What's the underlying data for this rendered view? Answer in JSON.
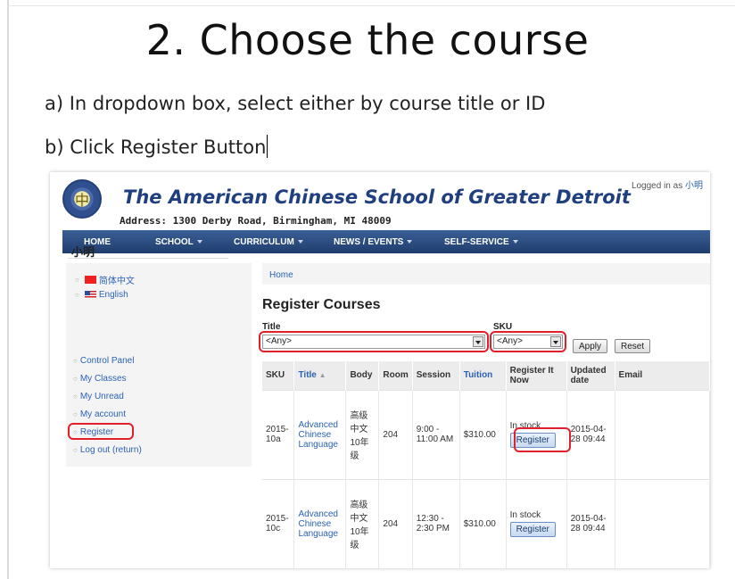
{
  "slide": {
    "title": "2. Choose the course",
    "bullet_a": "a) In dropdown box, select either by course title or ID",
    "bullet_b": "b) Click Register Button"
  },
  "site": {
    "school_name": "The American Chinese School of Greater Detroit",
    "address": "Address: 1300 Derby Road, Birmingham, MI 48009",
    "logged_in_prefix": "Logged in as",
    "logged_in_user": "小明",
    "logo_glyph": "中"
  },
  "nav": [
    {
      "label": "HOME",
      "dropdown": false
    },
    {
      "label": "SCHOOL",
      "dropdown": true
    },
    {
      "label": "CURRICULUM",
      "dropdown": true
    },
    {
      "label": "NEWS / EVENTS",
      "dropdown": true
    },
    {
      "label": "SELF-SERVICE",
      "dropdown": true
    }
  ],
  "sidebar": {
    "languages": [
      {
        "label": "简体中文",
        "flag": "cn-flag-icon"
      },
      {
        "label": "English",
        "flag": "us-flag-icon"
      }
    ],
    "user": "小明",
    "links": [
      {
        "label": "Control Panel"
      },
      {
        "label": "My Classes"
      },
      {
        "label": "My Unread"
      },
      {
        "label": "My account"
      },
      {
        "label": "Register",
        "highlighted": true
      },
      {
        "label": "Log out (return)"
      }
    ]
  },
  "main": {
    "breadcrumb": "Home",
    "page_title": "Register Courses",
    "filters": {
      "title_label": "Title",
      "title_value": "<Any>",
      "sku_label": "SKU",
      "sku_value": "<Any>",
      "apply_label": "Apply",
      "reset_label": "Reset"
    },
    "table": {
      "headers": {
        "sku": "SKU",
        "title": "Title",
        "title_sort": "▲",
        "body": "Body",
        "room": "Room",
        "session": "Session",
        "tuition": "Tuition",
        "register": "Register It Now",
        "updated": "Updated date",
        "email": "Email"
      },
      "rows": [
        {
          "sku": "2015-10a",
          "title": "Advanced Chinese Language",
          "body": "高级中文10年级",
          "room": "204",
          "session": "9:00 - 11:00 AM",
          "tuition": "$310.00",
          "stock": "In stock",
          "register_label": "Register",
          "updated": "2015-04-28 09:44",
          "email": ""
        },
        {
          "sku": "2015-10c",
          "title": "Advanced Chinese Language",
          "body": "高级中文10年级",
          "room": "204",
          "session": "12:30 - 2:30 PM",
          "tuition": "$310.00",
          "stock": "In stock",
          "register_label": "Register",
          "updated": "2015-04-28 09:44",
          "email": ""
        }
      ]
    }
  },
  "colors": {
    "brand_blue": "#1f3f7f",
    "nav_blue": "#2a4a80",
    "link_blue": "#2b62b5",
    "highlight_red": "#e0202a"
  }
}
